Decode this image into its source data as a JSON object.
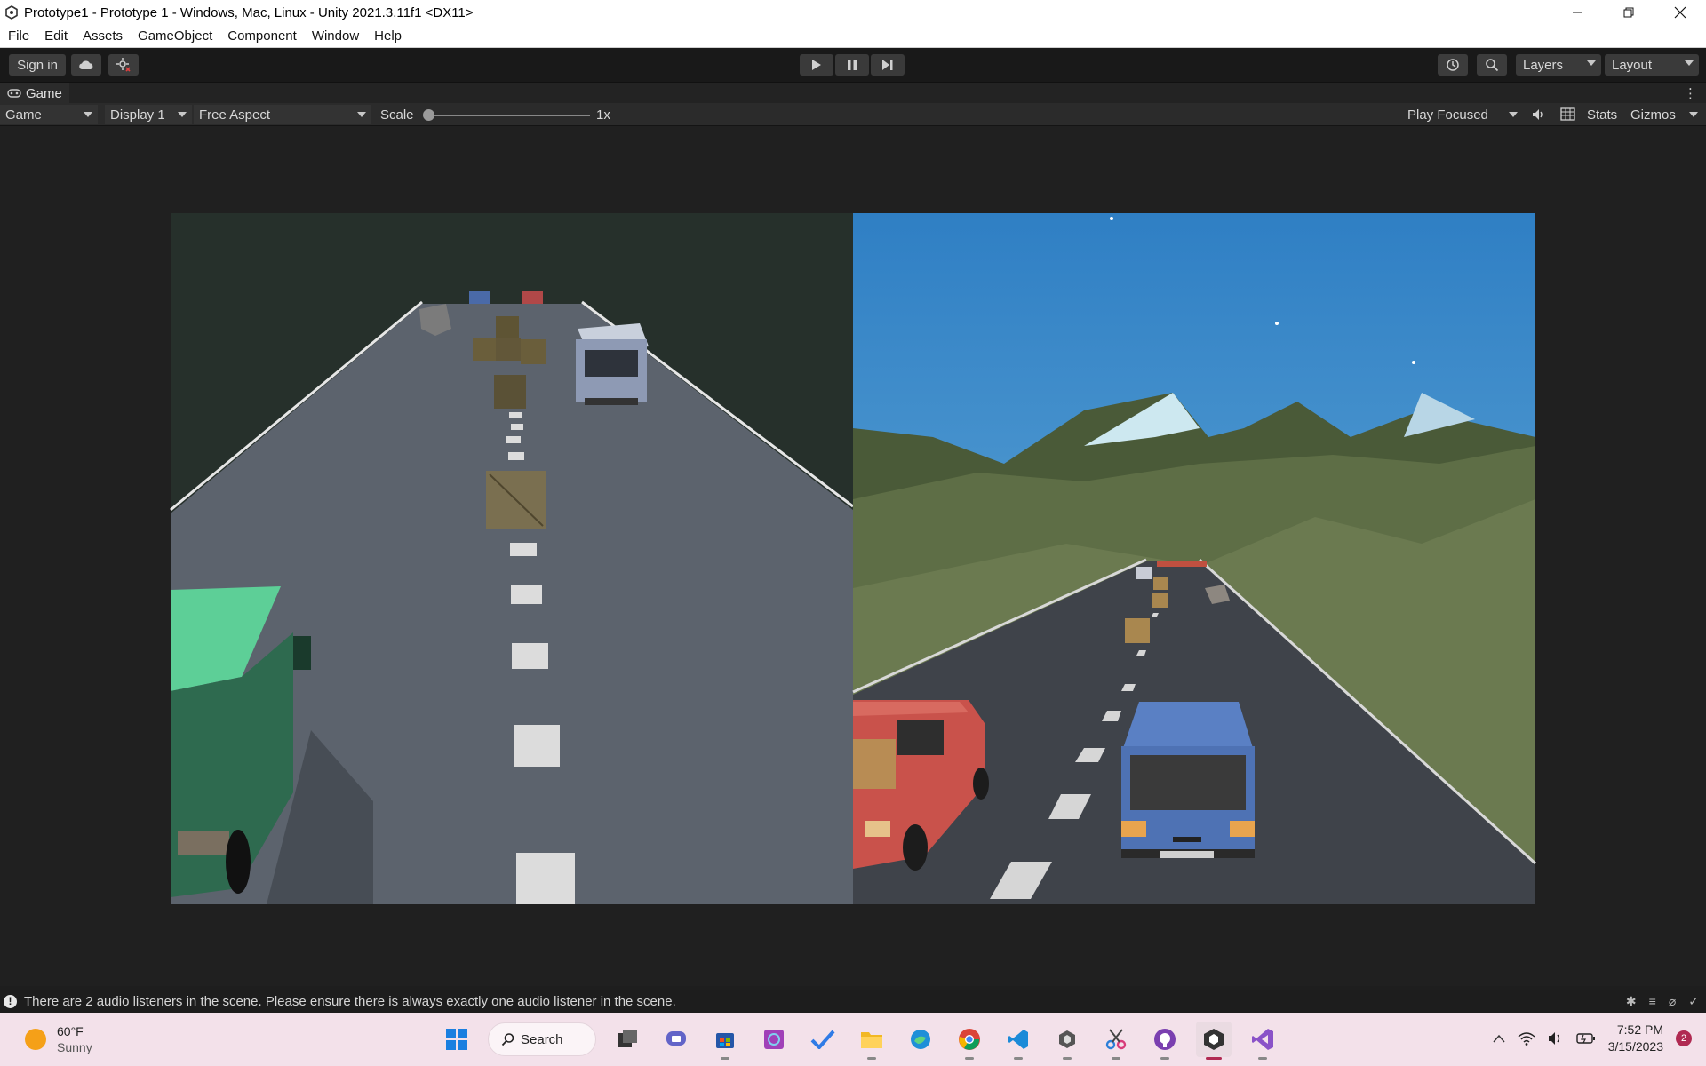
{
  "window": {
    "title": "Prototype1 - Prototype 1 - Windows, Mac, Linux - Unity 2021.3.11f1 <DX11>"
  },
  "menu": [
    "File",
    "Edit",
    "Assets",
    "GameObject",
    "Component",
    "Window",
    "Help"
  ],
  "toolbar": {
    "sign_in": "Sign in",
    "layers": "Layers",
    "layout": "Layout"
  },
  "tab": {
    "label": "Game"
  },
  "gamebar": {
    "mode": "Game",
    "display": "Display 1",
    "aspect": "Free Aspect",
    "scale_label": "Scale",
    "scale_value": "1x",
    "scale_level": 0,
    "play_focused": "Play Focused",
    "stats": "Stats",
    "gizmos": "Gizmos"
  },
  "status": {
    "message": "There are 2 audio listeners in the scene. Please ensure there is always exactly one audio listener in the scene."
  },
  "taskbar": {
    "temperature": "60°F",
    "condition": "Sunny",
    "search": "Search",
    "time": "7:52 PM",
    "date": "3/15/2023",
    "notifications": "2"
  },
  "colors": {
    "accent_unity": "#191919",
    "sky": "#3b88c8",
    "grass": "#5d6e44"
  }
}
